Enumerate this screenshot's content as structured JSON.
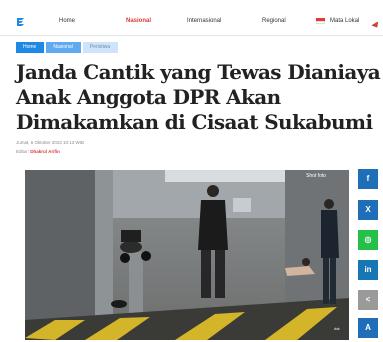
{
  "nav": {
    "items": [
      {
        "label": "Home"
      },
      {
        "label": "Nasional"
      },
      {
        "label": "Internasional"
      },
      {
        "label": "Regional"
      },
      {
        "label": "Mata Lokal"
      }
    ]
  },
  "breadcrumb": [
    "Home",
    "Nasional",
    "Peristiwa"
  ],
  "article": {
    "title": "Janda Cantik yang Tewas Dianiaya Anak Anggota DPR Akan Dimakamkan di Cisaat Sukabumi",
    "date": "Jumat, 6 Oktober 2023 10:13 WIB",
    "editor_label": "Editor:",
    "editor_name": "Dhakrul Arifin"
  },
  "photo": {
    "source_label": "Shot foto",
    "watermark": "dok"
  },
  "share": [
    {
      "icon": "facebook-icon",
      "glyph": "f",
      "color": "#1f6fb8"
    },
    {
      "icon": "x-icon",
      "glyph": "X",
      "color": "#1f6fb8"
    },
    {
      "icon": "whatsapp-icon",
      "glyph": "◎",
      "color": "#25c04a"
    },
    {
      "icon": "linkedin-icon",
      "glyph": "in",
      "color": "#1777b5"
    },
    {
      "icon": "share-icon",
      "glyph": "<",
      "color": "#9a9a9a"
    },
    {
      "icon": "font-size-icon",
      "glyph": "A",
      "color": "#1f6fb8"
    }
  ],
  "colors": {
    "accent": "#d43c3c",
    "breadcrumb": "#1e88e5"
  }
}
